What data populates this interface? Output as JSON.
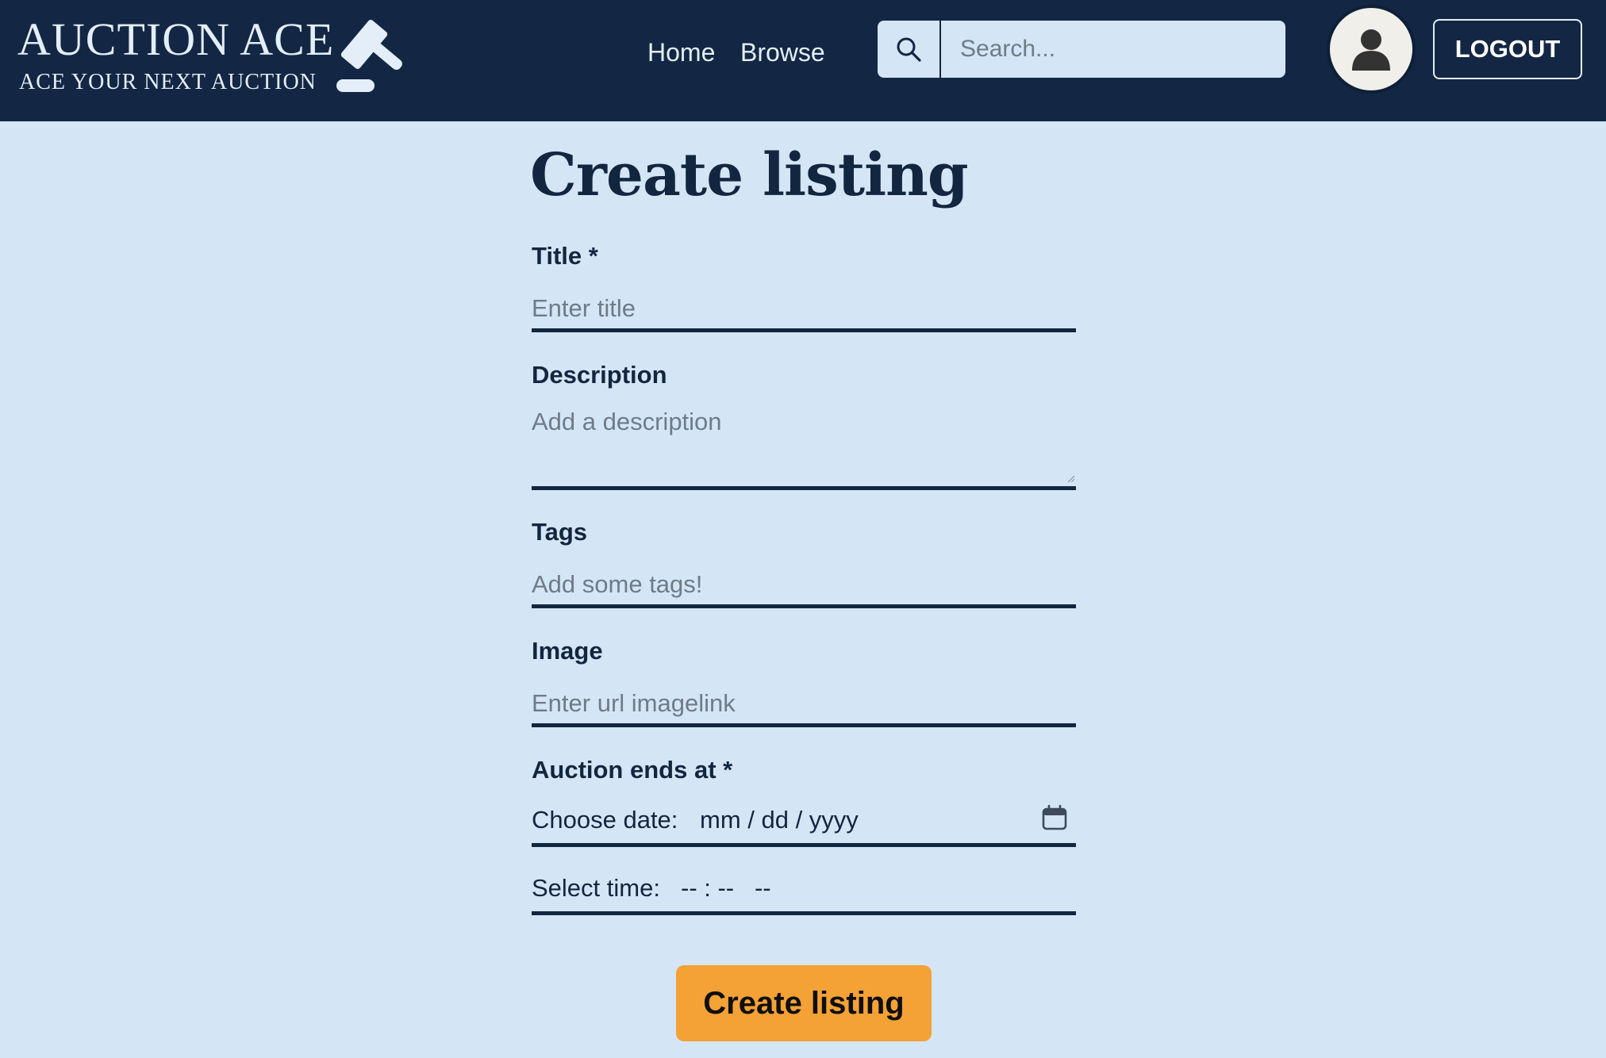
{
  "header": {
    "brand_name": "AUCTION ACE",
    "brand_tagline": "ACE YOUR NEXT AUCTION",
    "nav": {
      "home": "Home",
      "browse": "Browse"
    },
    "search": {
      "placeholder": "Search..."
    },
    "logout_label": "LOGOUT"
  },
  "form": {
    "title": "Create listing",
    "title_field": {
      "label": "Title *",
      "placeholder": "Enter title"
    },
    "description_field": {
      "label": "Description",
      "placeholder": "Add a description"
    },
    "tags_field": {
      "label": "Tags",
      "placeholder": "Add some tags!"
    },
    "image_field": {
      "label": "Image",
      "placeholder": "Enter url imagelink"
    },
    "ends_at": {
      "label": "Auction ends at *",
      "date_label": "Choose date:",
      "date_value": "mm / dd / yyyy",
      "time_label": "Select time:",
      "time_value": "-- : --   --"
    },
    "submit_label": "Create listing"
  },
  "colors": {
    "header_bg": "#132744",
    "page_bg": "#d4e6f5",
    "text_dark": "#13263f",
    "accent_button": "#f4a136"
  },
  "icons": {
    "brand": "gavel-icon",
    "search": "search-icon",
    "avatar": "user-icon",
    "date": "calendar-icon"
  }
}
